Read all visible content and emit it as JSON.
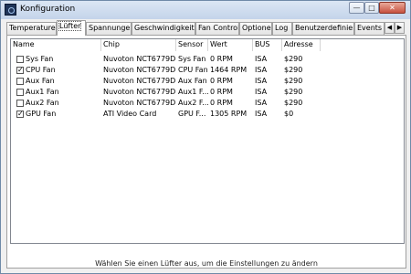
{
  "window": {
    "title": "Konfiguration",
    "buttons": {
      "minimize": "—",
      "maximize": "□",
      "close": "✕"
    }
  },
  "tabs": [
    {
      "label": "Temperaturen",
      "active": false
    },
    {
      "label": "Lüfter",
      "active": true
    },
    {
      "label": "Spannungen",
      "active": false
    },
    {
      "label": "Geschwindigkeiten",
      "active": false
    },
    {
      "label": "Fan Control",
      "active": false
    },
    {
      "label": "Optionen",
      "active": false
    },
    {
      "label": "Log",
      "active": false
    },
    {
      "label": "Benutzerdefiniert",
      "active": false
    },
    {
      "label": "Events",
      "active": false
    }
  ],
  "tab_scroll": {
    "left": "◀",
    "right": "▶"
  },
  "table": {
    "columns": [
      "Name",
      "Chip",
      "Sensor",
      "Wert",
      "BUS",
      "Adresse"
    ],
    "rows": [
      {
        "checked": false,
        "cells": [
          "Sys Fan",
          "Nuvoton NCT6779D",
          "Sys Fan",
          "0 RPM",
          "ISA",
          "$290"
        ]
      },
      {
        "checked": true,
        "cells": [
          "CPU Fan",
          "Nuvoton NCT6779D",
          "CPU Fan",
          "1464 RPM",
          "ISA",
          "$290"
        ]
      },
      {
        "checked": false,
        "cells": [
          "Aux Fan",
          "Nuvoton NCT6779D",
          "Aux Fan",
          "0 RPM",
          "ISA",
          "$290"
        ]
      },
      {
        "checked": false,
        "cells": [
          "Aux1 Fan",
          "Nuvoton NCT6779D",
          "Aux1 F...",
          "0 RPM",
          "ISA",
          "$290"
        ]
      },
      {
        "checked": false,
        "cells": [
          "Aux2 Fan",
          "Nuvoton NCT6779D",
          "Aux2 F...",
          "0 RPM",
          "ISA",
          "$290"
        ]
      },
      {
        "checked": true,
        "cells": [
          "GPU Fan",
          "ATI Video Card",
          "GPU F...",
          "1305 RPM",
          "ISA",
          "$0"
        ]
      }
    ]
  },
  "hint": "Wählen Sie einen Lüfter aus, um die Einstellungen zu ändern",
  "colors": {
    "title_bar": "#c4d4ea",
    "close_button": "#c7513f"
  }
}
